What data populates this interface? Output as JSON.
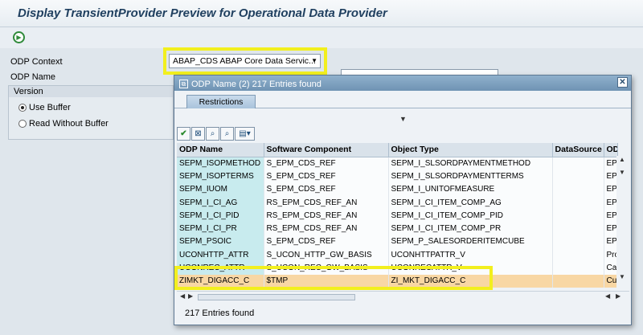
{
  "window": {
    "title": "Display TransientProvider Preview for Operational Data Provider"
  },
  "toolbar": {
    "execute_icon": "execute-icon"
  },
  "form": {
    "odp_context_label": "ODP Context",
    "odp_context_value": "ABAP_CDS ABAP Core Data Servic...",
    "odp_name_label": "ODP Name",
    "version_label": "Version",
    "options": [
      "Use Buffer",
      "Read Without Buffer"
    ],
    "selected_option": "Use Buffer"
  },
  "popup": {
    "title": "ODP Name (2)  217 Entries found",
    "tab_label": "Restrictions",
    "columns": [
      "ODP Name",
      "Software Component",
      "Object Type",
      "DataSource",
      "OD"
    ],
    "rows": [
      [
        "SEPM_ISOPMETHOD",
        "S_EPM_CDS_REF",
        "SEPM_I_SLSORDPAYMENTMETHOD",
        "",
        "EP"
      ],
      [
        "SEPM_ISOPTERMS",
        "S_EPM_CDS_REF",
        "SEPM_I_SLSORDPAYMENTTERMS",
        "",
        "EP"
      ],
      [
        "SEPM_IUOM",
        "S_EPM_CDS_REF",
        "SEPM_I_UNITOFMEASURE",
        "",
        "EP"
      ],
      [
        "SEPM_I_CI_AG",
        "RS_EPM_CDS_REF_AN",
        "SEPM_I_CI_ITEM_COMP_AG",
        "",
        "EP"
      ],
      [
        "SEPM_I_CI_PID",
        "RS_EPM_CDS_REF_AN",
        "SEPM_I_CI_ITEM_COMP_PID",
        "",
        "EP"
      ],
      [
        "SEPM_I_CI_PR",
        "RS_EPM_CDS_REF_AN",
        "SEPM_I_CI_ITEM_COMP_PR",
        "",
        "EP"
      ],
      [
        "SEPM_PSOIC",
        "S_EPM_CDS_REF",
        "SEPM_P_SALESORDERITEMCUBE",
        "",
        "EP"
      ],
      [
        "UCONHTTP_ATTR",
        "S_UCON_HTTP_GW_BASIS",
        "UCONHTTPATTR_V",
        "",
        "Pro"
      ],
      [
        "UCONREC_ATTR",
        "S_UCON_REC_GW_BASIS",
        "UCONRECATTR_V",
        "",
        "Cal"
      ],
      [
        "ZIMKT_DIGACC_C",
        "$TMP",
        "ZI_MKT_DIGACC_C",
        "",
        "Cu"
      ]
    ],
    "selected_row": 9,
    "status_text": "217 Entries found"
  },
  "colors": {
    "highlight": "#f2ef1e",
    "selected_row": "#f8d7a4",
    "key_column": "#c8ebee"
  }
}
